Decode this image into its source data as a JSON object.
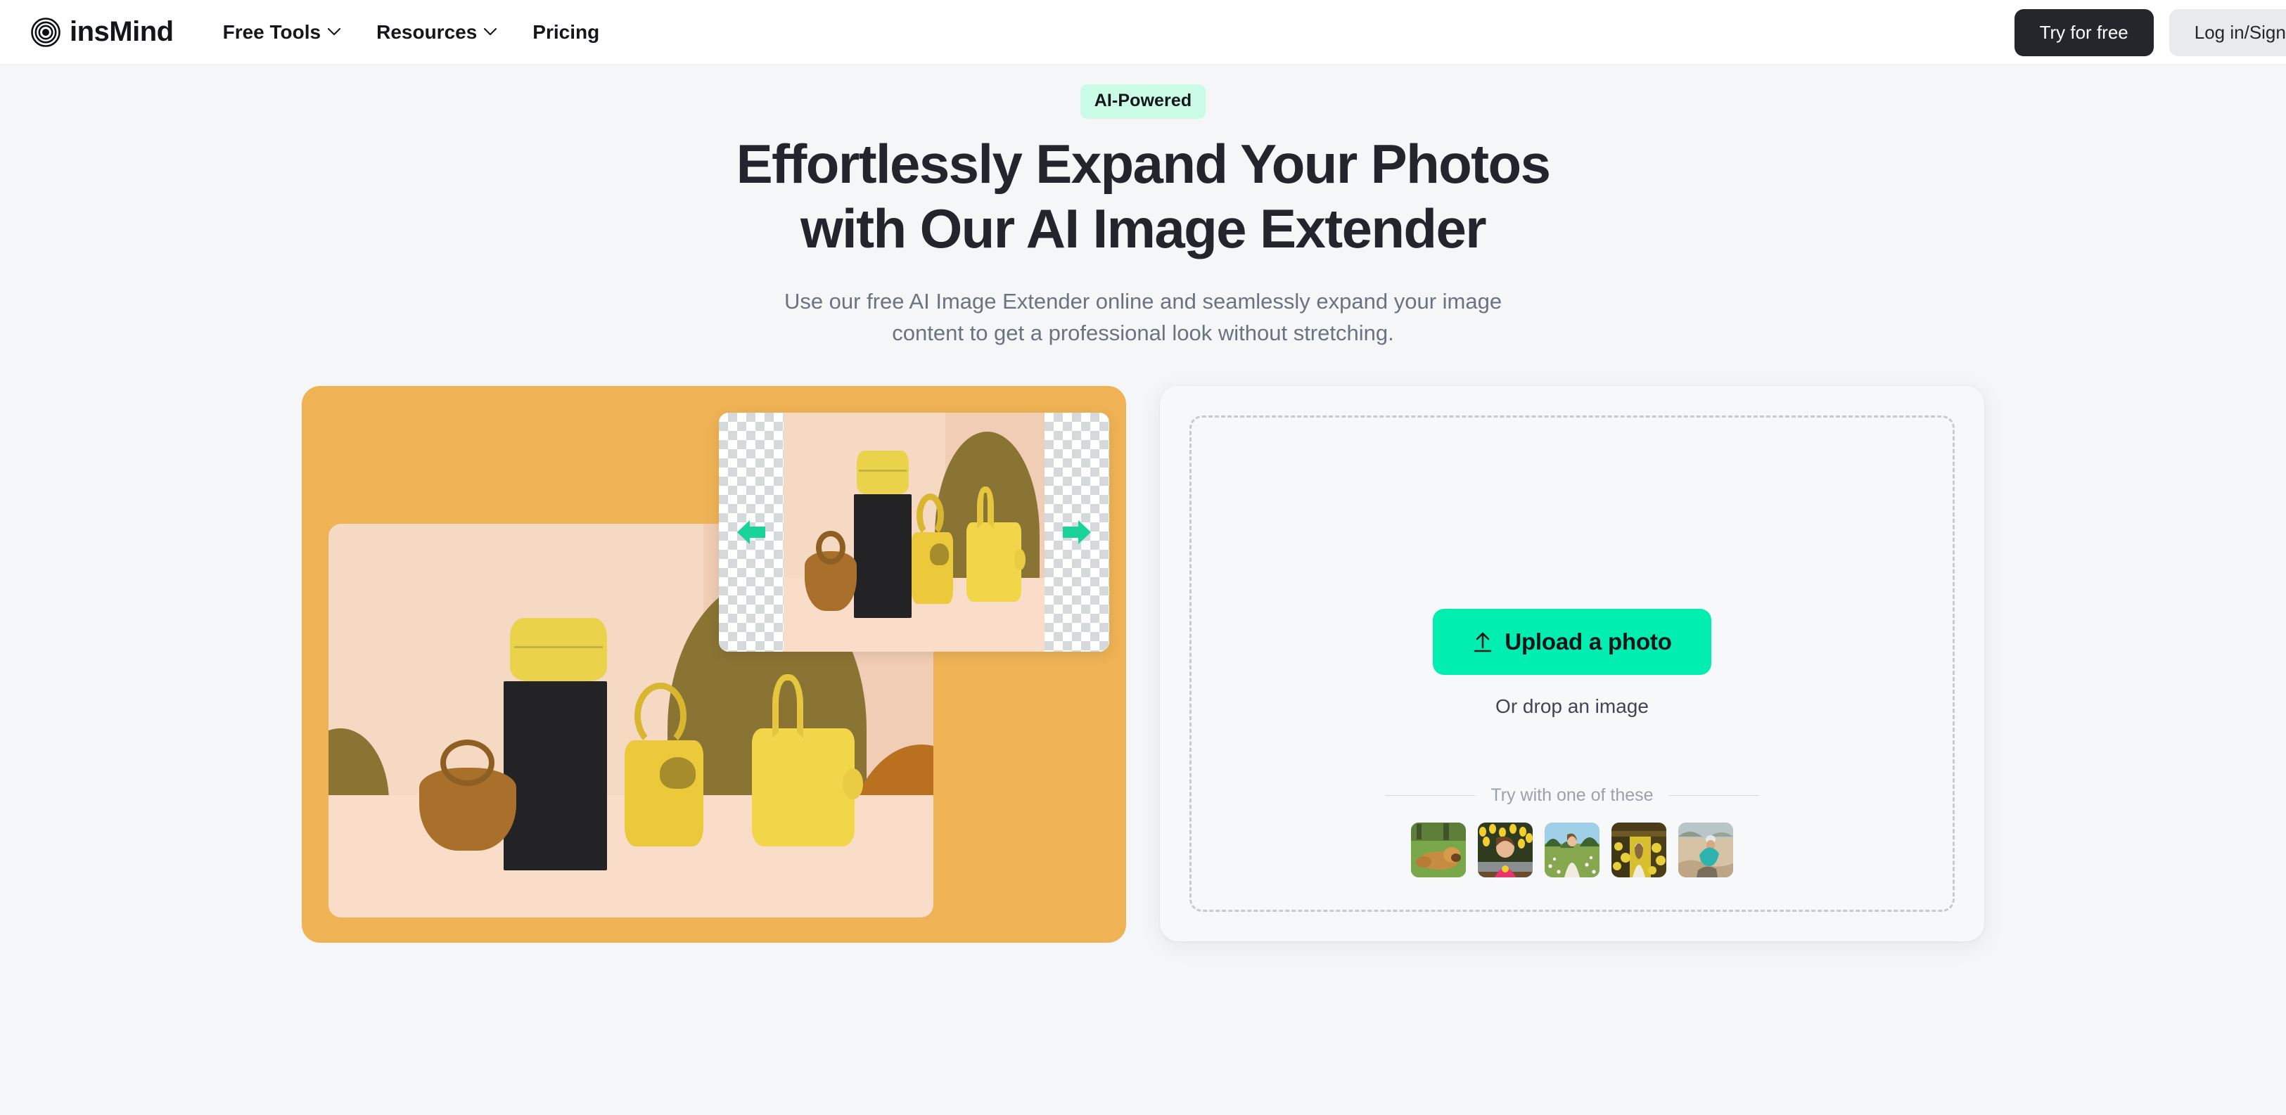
{
  "header": {
    "brand_name": "insMind",
    "logo_icon": "insmind-target-logo-icon",
    "nav": [
      {
        "label": "Free Tools",
        "has_dropdown": true,
        "icon": "chevron-down-icon"
      },
      {
        "label": "Resources",
        "has_dropdown": true,
        "icon": "chevron-down-icon"
      },
      {
        "label": "Pricing",
        "has_dropdown": false
      }
    ],
    "try_label": "Try for free",
    "login_label": "Log in/Sign up"
  },
  "hero": {
    "badge": "AI-Powered",
    "title": "Effortlessly Expand Your Photos with Our AI Image Extender",
    "subtitle": "Use our free AI Image Extender online and seamlessly expand your image content to get a professional look without stretching."
  },
  "demo": {
    "card_color": "#efb355",
    "arrow_color": "#18d49a",
    "left_arrow_icon": "arrow-left-icon",
    "right_arrow_icon": "arrow-right-icon",
    "result_alt": "Expanded product photo of yellow and brown leather handbags on a pedestal",
    "source_alt": "Original product photo with transparent areas to be extended on left and right"
  },
  "upload": {
    "button_label": "Upload a photo",
    "upload_icon": "upload-arrow-icon",
    "drop_hint": "Or drop an image",
    "try_label": "Try with one of these",
    "accent_color": "#00eeb0",
    "samples": [
      {
        "name": "golden-retriever-on-grass"
      },
      {
        "name": "girl-with-yellow-tulips"
      },
      {
        "name": "woman-in-daisy-meadow"
      },
      {
        "name": "girl-in-yellow-rapeseed-field"
      },
      {
        "name": "person-in-cap-on-rocks"
      }
    ]
  }
}
